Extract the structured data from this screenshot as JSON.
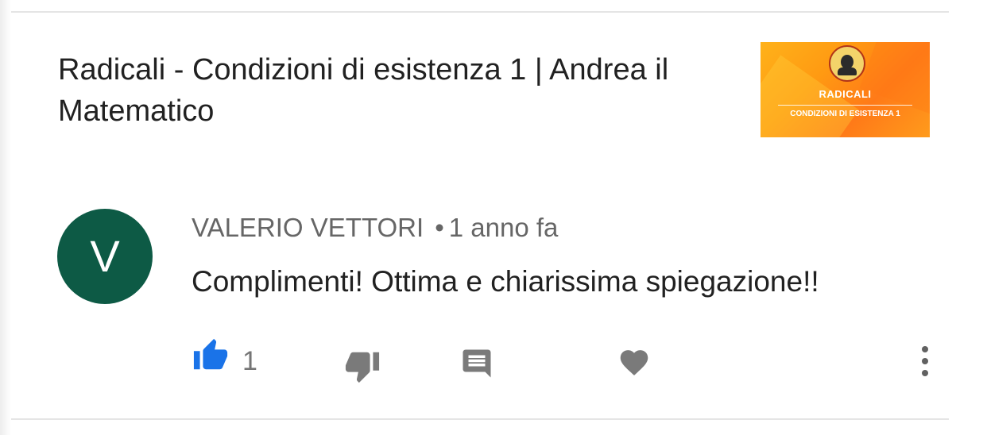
{
  "video": {
    "title": "Radicali - Condizioni di esistenza 1 | Andrea il Matematico",
    "thumbnail": {
      "title": "RADICALI",
      "subtitle": "CONDIZIONI DI ESISTENZA 1",
      "colors": [
        "#ffb21a",
        "#ff7a18"
      ]
    }
  },
  "comment": {
    "avatar_letter": "V",
    "avatar_color": "#0d5a45",
    "author": "VALERIO VETTORI",
    "separator": "•",
    "time": "1 anno fa",
    "text": "Complimenti! Ottima e chiarissima spiegazione!!",
    "like_count": "1",
    "like_color": "#1a73e8",
    "icons": [
      "thumb-up-icon",
      "thumb-down-icon",
      "reply-icon",
      "heart-icon",
      "more-vert-icon"
    ]
  }
}
